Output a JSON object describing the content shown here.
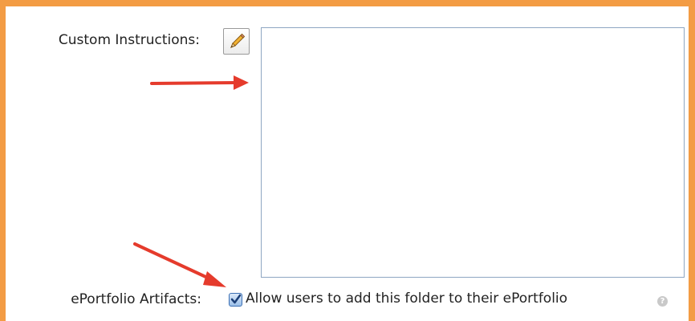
{
  "form": {
    "custom_instructions": {
      "label": "Custom Instructions:",
      "edit_icon": "pencil-icon",
      "value": ""
    },
    "eportfolio": {
      "label": "ePortfolio Artifacts:",
      "checkbox_label": "Allow users to add this folder to their ePortfolio",
      "checked": true,
      "help_icon": "question-circle-icon",
      "help_glyph": "?"
    }
  },
  "annotations": {
    "arrow_color": "#e53b2c",
    "arrow_count": 2
  },
  "colors": {
    "frame_border": "#f39c44",
    "textarea_border": "#8ea6c2",
    "checkbox_accent": "#3b6fb3"
  }
}
